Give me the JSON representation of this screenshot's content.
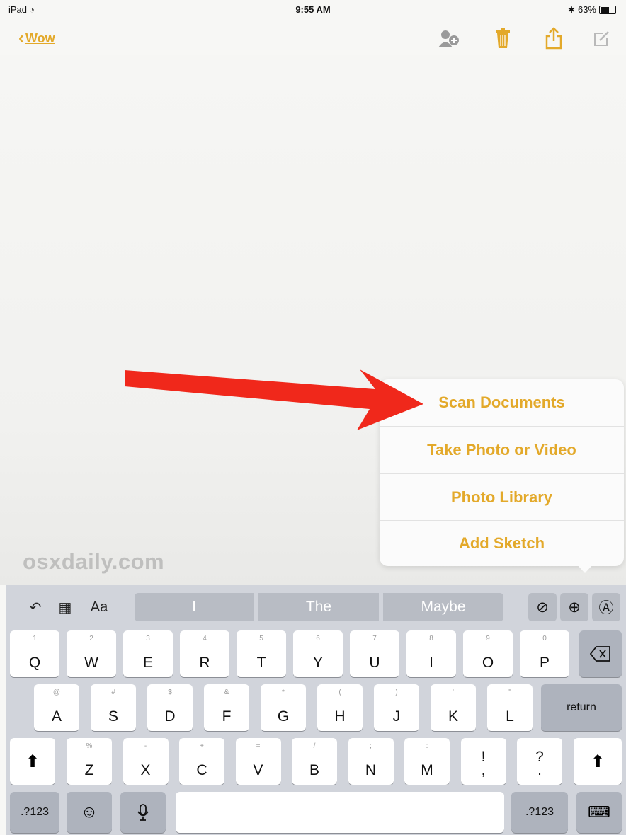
{
  "status": {
    "device": "iPad",
    "wifi_icon": "wifi-icon",
    "time": "9:55 AM",
    "bluetooth_icon": "bluetooth-icon",
    "battery": "63%"
  },
  "navbar": {
    "back_label": "Wow",
    "icons": [
      "add-people-icon",
      "trash-icon",
      "share-icon",
      "compose-icon"
    ],
    "accent": "#e3a92a"
  },
  "popover": {
    "items": [
      "Scan Documents",
      "Take Photo or Video",
      "Photo Library",
      "Add Sketch"
    ]
  },
  "watermark": "osxdaily.com",
  "annotation": {
    "arrow_color": "#f0281b"
  },
  "keyboard": {
    "toolbar": {
      "left_icons": [
        "undo-icon",
        "table-icon",
        "format-text-icon"
      ],
      "format_label": "Aa",
      "predictions": [
        "I",
        "The",
        "Maybe"
      ],
      "right_icons": [
        "checklist-icon",
        "add-icon",
        "markup-icon"
      ]
    },
    "row1": [
      {
        "main": "Q",
        "alt": "1"
      },
      {
        "main": "W",
        "alt": "2"
      },
      {
        "main": "E",
        "alt": "3"
      },
      {
        "main": "R",
        "alt": "4"
      },
      {
        "main": "T",
        "alt": "5"
      },
      {
        "main": "Y",
        "alt": "6"
      },
      {
        "main": "U",
        "alt": "7"
      },
      {
        "main": "I",
        "alt": "8"
      },
      {
        "main": "O",
        "alt": "9"
      },
      {
        "main": "P",
        "alt": "0"
      }
    ],
    "row2": [
      {
        "main": "A",
        "alt": "@"
      },
      {
        "main": "S",
        "alt": "#"
      },
      {
        "main": "D",
        "alt": "$"
      },
      {
        "main": "F",
        "alt": "&"
      },
      {
        "main": "G",
        "alt": "*"
      },
      {
        "main": "H",
        "alt": "("
      },
      {
        "main": "J",
        "alt": ")"
      },
      {
        "main": "K",
        "alt": "'"
      },
      {
        "main": "L",
        "alt": "\""
      }
    ],
    "row3": [
      {
        "main": "Z",
        "alt": "%"
      },
      {
        "main": "X",
        "alt": "-"
      },
      {
        "main": "C",
        "alt": "+"
      },
      {
        "main": "V",
        "alt": "="
      },
      {
        "main": "B",
        "alt": "/"
      },
      {
        "main": "N",
        "alt": ";"
      },
      {
        "main": "M",
        "alt": ":"
      },
      {
        "main": "!\n,",
        "alt": ""
      },
      {
        "main": "?\n.",
        "alt": ""
      }
    ],
    "return_label": "return",
    "numbers_label": ".?123",
    "delete_icon": "delete-icon",
    "shift_icon": "shift-icon",
    "emoji_icon": "emoji-icon",
    "mic_icon": "microphone-icon",
    "dismiss_icon": "keyboard-dismiss-icon"
  }
}
